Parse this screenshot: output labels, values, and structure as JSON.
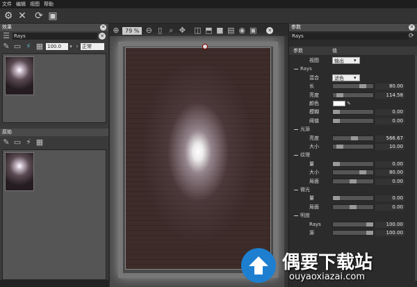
{
  "menu": [
    "文件",
    "编辑",
    "视图",
    "帮助"
  ],
  "canvas_toolbar": {
    "zoom": "79 %"
  },
  "left_panel": {
    "effects_title": "效果",
    "effects_search": "Rays",
    "opacity_value": "100.0",
    "blend_mode": "正常",
    "source_title": "原始"
  },
  "right_panel": {
    "title": "参数",
    "search": "Rays",
    "col_param": "参数",
    "col_value": "值"
  },
  "params": [
    {
      "label": "视图",
      "kind": "dropdown",
      "value": "输出"
    },
    {
      "label": "Rays",
      "kind": "section"
    },
    {
      "label": "混合",
      "kind": "dropdown",
      "value": "滤色"
    },
    {
      "label": "长",
      "kind": "slider",
      "value": "80.00",
      "level": 0.8
    },
    {
      "label": "亮度",
      "kind": "slider",
      "value": "114.58",
      "level": 0.11
    },
    {
      "label": "颜色",
      "kind": "color"
    },
    {
      "label": "模糊",
      "kind": "slider",
      "value": "0.00",
      "level": 0
    },
    {
      "label": "阈值",
      "kind": "slider",
      "value": "0.00",
      "level": 0
    },
    {
      "label": "光源",
      "kind": "section"
    },
    {
      "label": "亮度",
      "kind": "slider",
      "value": "566.67",
      "level": 0.55
    },
    {
      "label": "大小",
      "kind": "slider",
      "value": "10.00",
      "level": 0.1
    },
    {
      "label": "纹理",
      "kind": "section"
    },
    {
      "label": "量",
      "kind": "slider",
      "value": "0.00",
      "level": 0
    },
    {
      "label": "大小",
      "kind": "slider",
      "value": "80.00",
      "level": 0.8
    },
    {
      "label": "局面",
      "kind": "slider",
      "value": "0.00",
      "level": 0.5
    },
    {
      "label": "微光",
      "kind": "section"
    },
    {
      "label": "量",
      "kind": "slider",
      "value": "0.00",
      "level": 0
    },
    {
      "label": "局面",
      "kind": "slider",
      "value": "0.00",
      "level": 0.5
    },
    {
      "label": "明度",
      "kind": "section"
    },
    {
      "label": "Rays",
      "kind": "slider",
      "value": "100.00",
      "level": 1
    },
    {
      "label": "源",
      "kind": "slider",
      "value": "100.00",
      "level": 1
    }
  ],
  "watermark": {
    "cn": "偶要下载站",
    "url": "ouyaoxiazai.com"
  }
}
